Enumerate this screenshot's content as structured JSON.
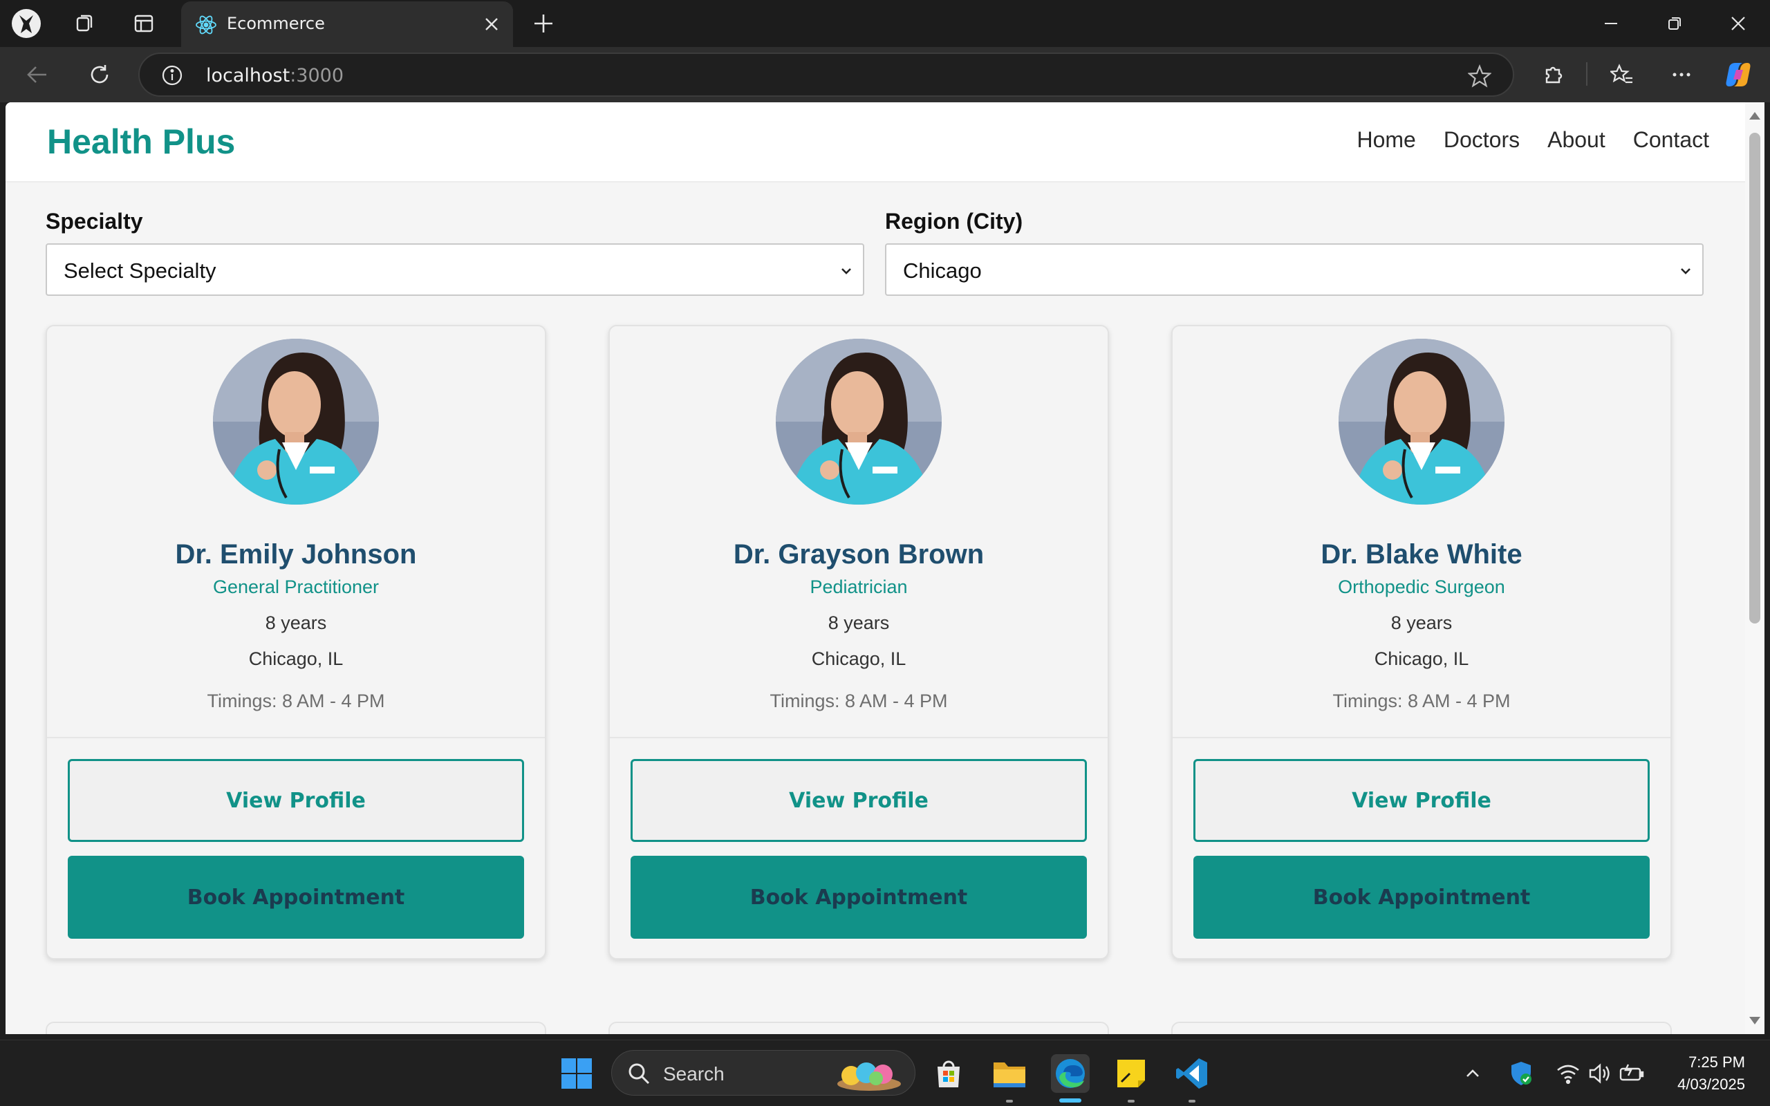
{
  "browser": {
    "tab_title": "Ecommerce",
    "address_host": "localhost",
    "address_port": ":3000"
  },
  "site": {
    "brand": "Health Plus",
    "nav": [
      "Home",
      "Doctors",
      "About",
      "Contact"
    ]
  },
  "filters": {
    "specialty_label": "Specialty",
    "specialty_value": "Select Specialty",
    "region_label": "Region (City)",
    "region_value": "Chicago"
  },
  "doctors": [
    {
      "name": "Dr. Emily Johnson",
      "specialty": "General Practitioner",
      "experience": "8 years",
      "location": "Chicago, IL",
      "timings": "Timings: 8 AM - 4 PM"
    },
    {
      "name": "Dr. Grayson Brown",
      "specialty": "Pediatrician",
      "experience": "8 years",
      "location": "Chicago, IL",
      "timings": "Timings: 8 AM - 4 PM"
    },
    {
      "name": "Dr. Blake White",
      "specialty": "Orthopedic Surgeon",
      "experience": "8 years",
      "location": "Chicago, IL",
      "timings": "Timings: 8 AM - 4 PM"
    }
  ],
  "buttons": {
    "view_profile": "View Profile",
    "book_appointment": "Book Appointment"
  },
  "taskbar": {
    "search_placeholder": "Search",
    "time": "7:25 PM",
    "date": "4/03/2025"
  },
  "colors": {
    "accent": "#119288",
    "doctor_name": "#1f4e6e",
    "active_indicator": "#4cc2ff"
  }
}
